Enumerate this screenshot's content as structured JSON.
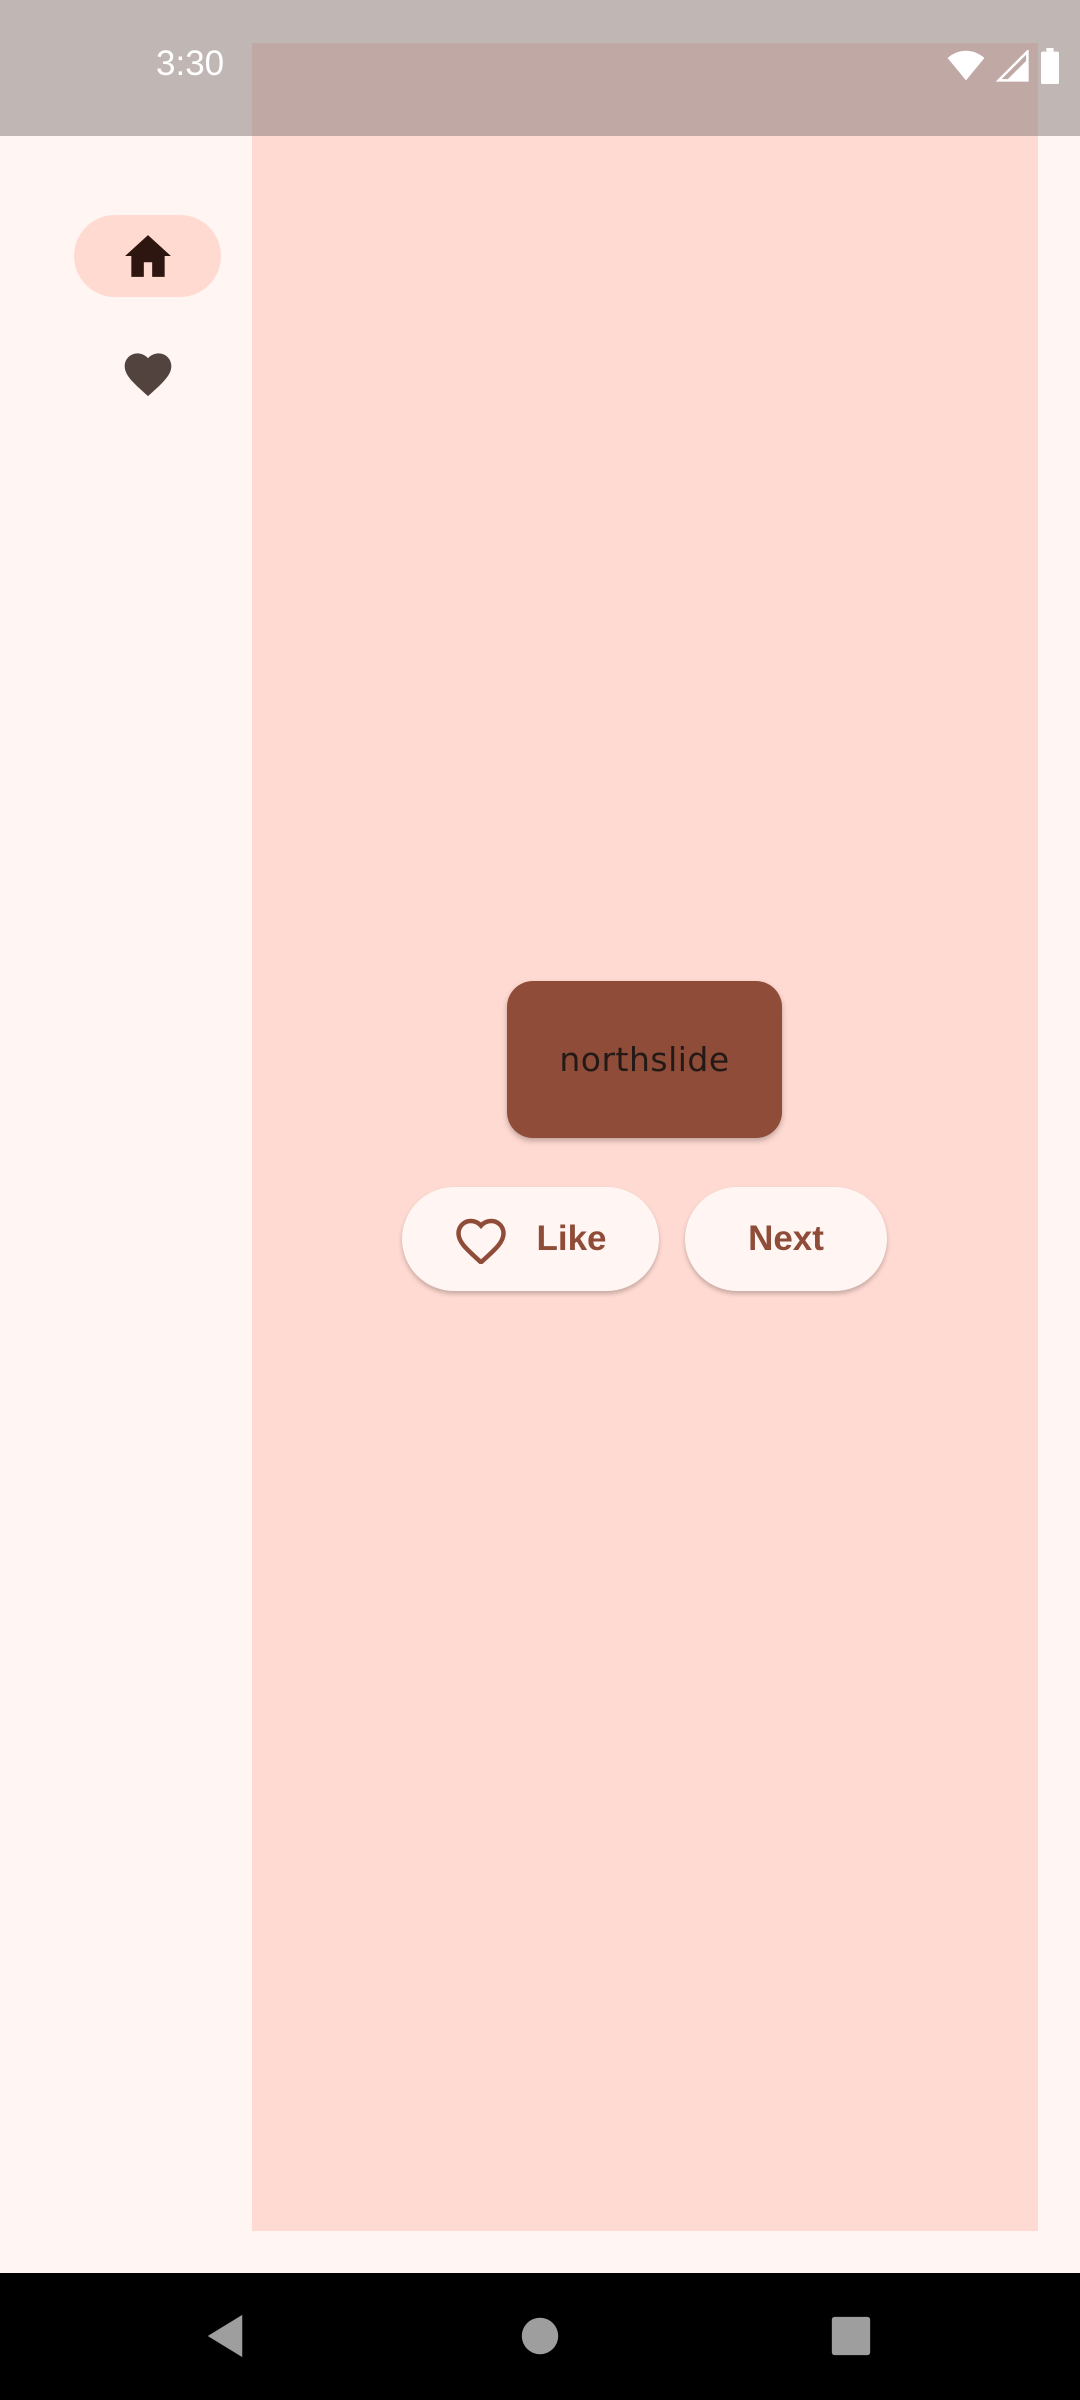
{
  "status_bar": {
    "time": "3:30",
    "icons": [
      "wifi-icon",
      "cellular-signal-icon",
      "battery-icon"
    ]
  },
  "nav_rail": {
    "items": [
      {
        "icon": "home-icon",
        "selected": true
      },
      {
        "icon": "favorite-icon",
        "selected": false
      }
    ]
  },
  "main": {
    "word": "northslide",
    "like_button": {
      "icon": "heart-outline-icon",
      "label": "Like"
    },
    "next_button": {
      "label": "Next"
    }
  },
  "system_nav": {
    "buttons": [
      "back-icon",
      "home-circle-icon",
      "recents-icon"
    ]
  },
  "colors": {
    "background": "#fff5f3",
    "content_pane": "#ffdad2",
    "primary": "#8f4c38",
    "rail_indicator": "#ffdad1",
    "on_surface": "#231917"
  }
}
